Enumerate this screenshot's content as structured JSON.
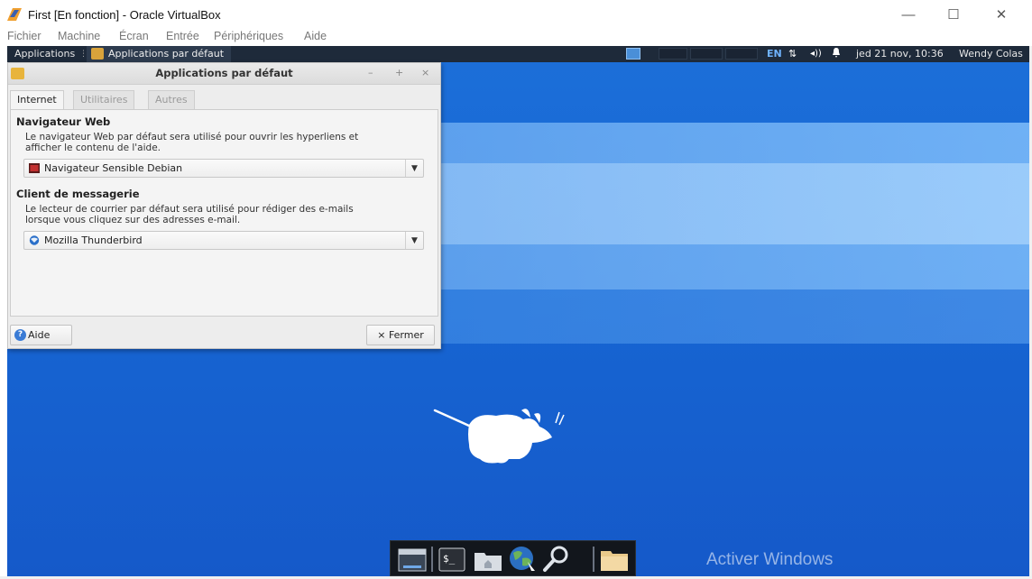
{
  "host": {
    "window_title": "First [En fonction] - Oracle VirtualBox",
    "controls": {
      "minimize": "—",
      "maximize": "☐",
      "close": "✕"
    },
    "menu": [
      "Fichier",
      "Machine",
      "Écran",
      "Entrée",
      "Périphériques",
      "Aide"
    ]
  },
  "panel": {
    "applications_label": "Applications",
    "task_label": "Applications par défaut",
    "lang": "EN",
    "net_glyph": "⇅",
    "volume_glyph": "◂))",
    "bell_glyph": "🔔",
    "clock": "jed 21 nov, 10:36",
    "user": "Wendy Colas",
    "active_workspace_color": "#4a8fd8"
  },
  "dialog": {
    "title": "Applications par défaut",
    "title_controls": {
      "minimize": "–",
      "maximize": "+",
      "close": "×"
    },
    "tabs": [
      {
        "label": "Internet",
        "active": true
      },
      {
        "label": "Utilitaires",
        "active": false
      },
      {
        "label": "Autres",
        "active": false
      }
    ],
    "web": {
      "title": "Navigateur Web",
      "desc_line1": "Le navigateur Web par défaut sera utilisé pour ouvrir les hyperliens et",
      "desc_line2": "afficher le contenu de l'aide.",
      "selected": "Navigateur Sensible Debian"
    },
    "mail": {
      "title": "Client de messagerie",
      "desc_line1": "Le lecteur de courrier par défaut sera utilisé pour rédiger des e-mails",
      "desc_line2": "lorsque vous cliquez sur des adresses e-mail.",
      "selected": "Mozilla Thunderbird"
    },
    "help_label": "Aide",
    "close_label": "Fermer",
    "close_glyph": "×"
  },
  "watermark": {
    "line1": "Activer Windows"
  },
  "colors": {
    "desktop_blue": "#1766d3",
    "panel_bg": "#1e2a3a",
    "dock_bg": "#12161c"
  }
}
